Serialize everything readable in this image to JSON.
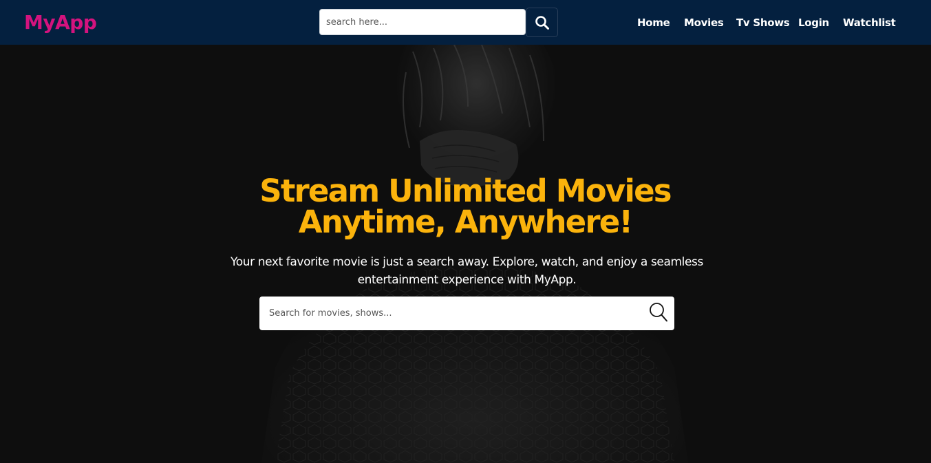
{
  "navbar": {
    "brand": "MyApp",
    "search_placeholder": "search here...",
    "links": [
      "Home",
      "Movies",
      "Tv Shows",
      "Login",
      "Watchlist"
    ]
  },
  "hero": {
    "title_line1": "Stream Unlimited Movies",
    "title_line2": "Anytime, Anywhere!",
    "subtitle_line1": "Your next favorite movie is just a search away. Explore, watch, and enjoy a seamless",
    "subtitle_line2": "entertainment experience with MyApp.",
    "search_placeholder": "Search for movies, shows..."
  },
  "colors": {
    "navbar_bg": "#04203f",
    "brand": "#d4137e",
    "hero_title": "#fbb30c",
    "hero_bg": "#0e0e0e"
  },
  "icons": {
    "nav_search": "search-icon",
    "hero_search": "search-icon"
  }
}
